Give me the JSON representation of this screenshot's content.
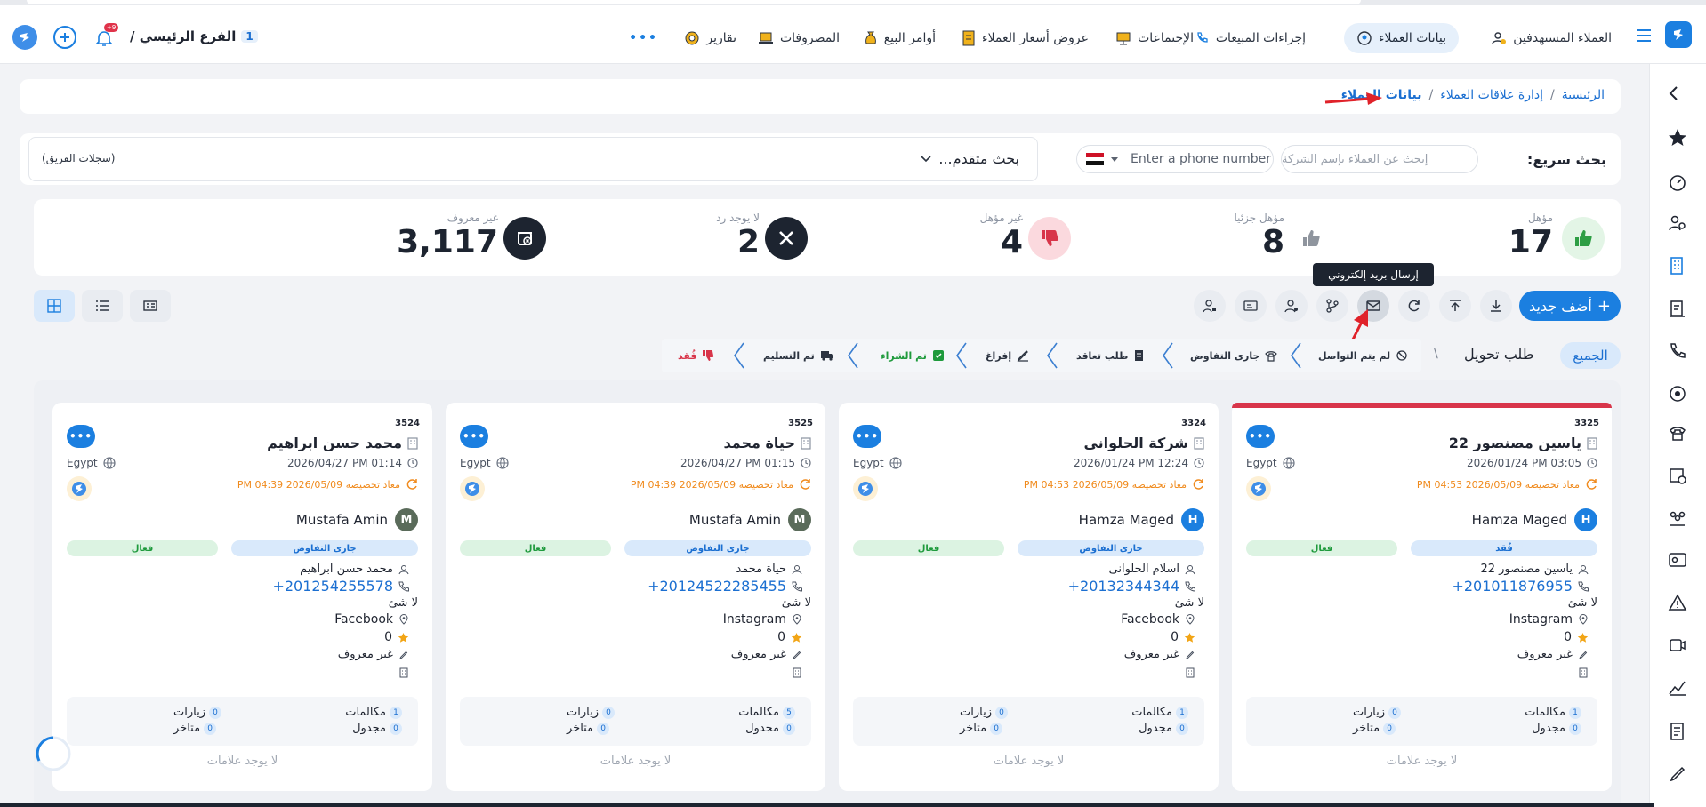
{
  "topbar": {
    "branch_label": "الفرع الرئيسي /",
    "branch_num": "1",
    "notif_count": "+9",
    "nav": [
      {
        "label": "العملاء المستهدفين"
      },
      {
        "label": "بيانات العملاء"
      },
      {
        "label": "إجراءات المبيعات"
      },
      {
        "label": "الإجتماعات"
      },
      {
        "label": "عروض أسعار العملاء"
      },
      {
        "label": "أوامر البيع"
      },
      {
        "label": "المصروفات"
      },
      {
        "label": "تقارير"
      }
    ],
    "more": "•••"
  },
  "breadcrumb": {
    "home": "الرئيسية",
    "sep": "/",
    "section": "إدارة علاقات العملاء",
    "current": "بيانات العملاء"
  },
  "search": {
    "label": "بحث سريع:",
    "company_placeholder": "إبحث عن العملاء بإسم الشركة",
    "phone_placeholder": "Enter a phone number",
    "advanced": "بحث متقدم...",
    "team_records": "(سجلات الفريق)"
  },
  "stats": [
    {
      "label": "مؤهل",
      "value": "17",
      "color": "#2e9e44",
      "bg": "#e3f5e6"
    },
    {
      "label": "مؤهل جزئيا",
      "value": "8",
      "color": "#8f959e",
      "bg": "#ffffff"
    },
    {
      "label": "غير مؤهل",
      "value": "4",
      "color": "#d8354a",
      "bg": "#fbd9de"
    },
    {
      "label": "لا يوجد رد",
      "value": "2",
      "color": "#1d2430",
      "bg": "#1d2430"
    },
    {
      "label": "غير معروف",
      "value": "3,117",
      "color": "#1d2430",
      "bg": "#1d2430"
    }
  ],
  "toolbar": {
    "add_label": "أضف جديد",
    "tooltip": "إرسال بريد إلكتروني"
  },
  "stages": {
    "all": "الجميع",
    "transfer": "طلب تحويل",
    "slash": "\\",
    "items": [
      {
        "label": "لم يتم التواصل",
        "color": "#2b3340"
      },
      {
        "label": "جارى التفاوض",
        "color": "#2b3340"
      },
      {
        "label": "طلب تعاقد",
        "color": "#2b3340"
      },
      {
        "label": "إفراغ",
        "color": "#2b3340"
      },
      {
        "label": "تم الشراء",
        "color": "#1e9a3c"
      },
      {
        "label": "تم التسليم",
        "color": "#2b3340"
      },
      {
        "label": "فُقد",
        "color": "#d8354a"
      }
    ]
  },
  "cards": [
    {
      "id": "3325",
      "name": "ياسين مصنصور 22",
      "date": "2026/01/24 PM 03:05",
      "country": "Egypt",
      "assign": "معاد تخصيصه 2026/05/09 PM 04:53",
      "owner": "Hamza Maged",
      "owner_initial": "H",
      "stage_pill": "فُقد",
      "status_pill": "فعال",
      "contact": "ياسين مصنصور 22",
      "phone": "+201011876955",
      "nothing": "لا شئ",
      "source": "Instagram",
      "rating": "0",
      "unknown": "غير معروف",
      "calls_label": "مكالمات",
      "calls": "1",
      "visits_label": "زيارات",
      "visits": "0",
      "sched_label": "مجدول",
      "sched": "0",
      "late_label": "متاخر",
      "late": "0",
      "no_tags": "لا يوجد علامات"
    },
    {
      "id": "3324",
      "name": "شركة الحلوانى",
      "date": "2026/01/24 PM 12:24",
      "country": "Egypt",
      "assign": "معاد تخصيصه 2026/05/09 PM 04:53",
      "owner": "Hamza Maged",
      "owner_initial": "H",
      "stage_pill": "جارى التفاوض",
      "status_pill": "فعال",
      "contact": "اسلام الحلوانى",
      "phone": "+20132344344",
      "nothing": "لا شئ",
      "source": "Facebook",
      "rating": "0",
      "unknown": "غير معروف",
      "calls_label": "مكالمات",
      "calls": "1",
      "visits_label": "زيارات",
      "visits": "0",
      "sched_label": "مجدول",
      "sched": "0",
      "late_label": "متاخر",
      "late": "0",
      "no_tags": "لا يوجد علامات"
    },
    {
      "id": "3525",
      "name": "حياة محمد",
      "date": "2026/04/27 PM 01:15",
      "country": "Egypt",
      "assign": "معاد تخصيصه 2026/05/09 PM 04:39",
      "owner": "Mustafa Amin",
      "owner_initial": "M",
      "stage_pill": "جارى التفاوض",
      "status_pill": "فعال",
      "contact": "حياة محمد",
      "phone": "+20124522285455",
      "nothing": "لا شئ",
      "source": "Instagram",
      "rating": "0",
      "unknown": "غير معروف",
      "calls_label": "مكالمات",
      "calls": "5",
      "visits_label": "زيارات",
      "visits": "0",
      "sched_label": "مجدول",
      "sched": "0",
      "late_label": "متاخر",
      "late": "0",
      "no_tags": "لا يوجد علامات"
    },
    {
      "id": "3524",
      "name": "محمد حسن ابراهيم",
      "date": "2026/04/27 PM 01:14",
      "country": "Egypt",
      "assign": "معاد تخصيصه 2026/05/09 PM 04:39",
      "owner": "Mustafa Amin",
      "owner_initial": "M",
      "stage_pill": "جارى التفاوض",
      "status_pill": "فعال",
      "contact": "محمد حسن ابراهيم",
      "phone": "+201254255578",
      "nothing": "لا شئ",
      "source": "Facebook",
      "rating": "0",
      "unknown": "غير معروف",
      "calls_label": "مكالمات",
      "calls": "1",
      "visits_label": "زيارات",
      "visits": "0",
      "sched_label": "مجدول",
      "sched": "0",
      "late_label": "متاخر",
      "late": "0",
      "no_tags": "لا يوجد علامات"
    }
  ],
  "colors": {
    "accent": "#1b7fe0",
    "danger": "#d8354a",
    "orange": "#f08a1c"
  }
}
